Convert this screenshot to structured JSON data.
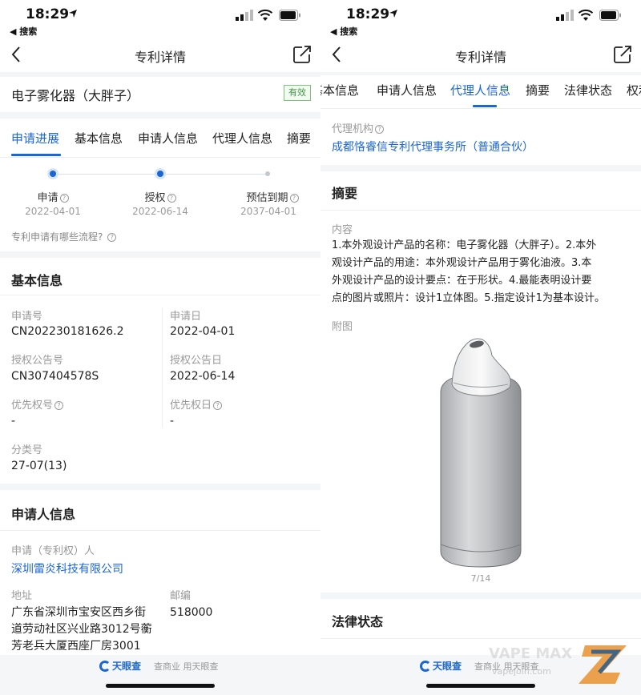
{
  "status_bar": {
    "time": "18:29",
    "back_app": "◀ 搜索"
  },
  "nav": {
    "title": "专利详情"
  },
  "patent": {
    "name": "电子雾化器（大胖子）",
    "status": "有效"
  },
  "left_tabs": [
    "申请进展",
    "基本信息",
    "申请人信息",
    "代理人信息",
    "摘要"
  ],
  "progress": {
    "steps": [
      {
        "label": "申请",
        "date": "2022-04-01",
        "state": "done"
      },
      {
        "label": "授权",
        "date": "2022-06-14",
        "state": "done"
      },
      {
        "label": "预估到期",
        "date": "2037-04-01",
        "state": "pending"
      }
    ],
    "flow_question": "专利申请有哪些流程?"
  },
  "basic_info": {
    "title": "基本信息",
    "app_no_label": "申请号",
    "app_no": "CN202230181626.2",
    "app_date_label": "申请日",
    "app_date": "2022-04-01",
    "grant_no_label": "授权公告号",
    "grant_no": "CN307404578S",
    "grant_date_label": "授权公告日",
    "grant_date": "2022-06-14",
    "priority_no_label": "优先权号",
    "priority_no": "-",
    "priority_date_label": "优先权日",
    "priority_date": "-",
    "class_label": "分类号",
    "class_no": "27-07(13)"
  },
  "applicant": {
    "title": "申请人信息",
    "holder_label": "申请（专利权）人",
    "holder": "深圳雷炎科技有限公司",
    "address_label": "地址",
    "address_line1": "广东省深圳市宝安区西乡街",
    "address_line2": "道劳动社区兴业路3012号蘅",
    "address_line3": "芳老兵大厦西座厂房3001",
    "postcode_label": "邮编",
    "postcode": "518000"
  },
  "footer": {
    "brand": "天眼查",
    "slogan": "查商业 用天眼查"
  },
  "right_tabs": [
    "基本信息",
    "申请人信息",
    "代理人信息",
    "摘要",
    "法律状态",
    "权利"
  ],
  "agency": {
    "label": "代理机构",
    "name": "成都恪睿信专利代理事务所（普通合伙）"
  },
  "abstract": {
    "title": "摘要",
    "content_label": "内容",
    "line1": "1.本外观设计产品的名称：电子雾化器（大胖子）。2.本外",
    "line2": "观设计产品的用途：本外观设计产品用于雾化油液。3.本",
    "line3": "外观设计产品的设计要点：在于形状。4.最能表明设计要",
    "line4": "点的图片或照片：设计1立体图。5.指定设计1为基本设计。",
    "figure_label": "附图",
    "image_index": "7/14"
  },
  "legal": {
    "title": "法律状态"
  },
  "watermark": {
    "text": "VAPE MAX",
    "url": "vapejoin.com"
  }
}
